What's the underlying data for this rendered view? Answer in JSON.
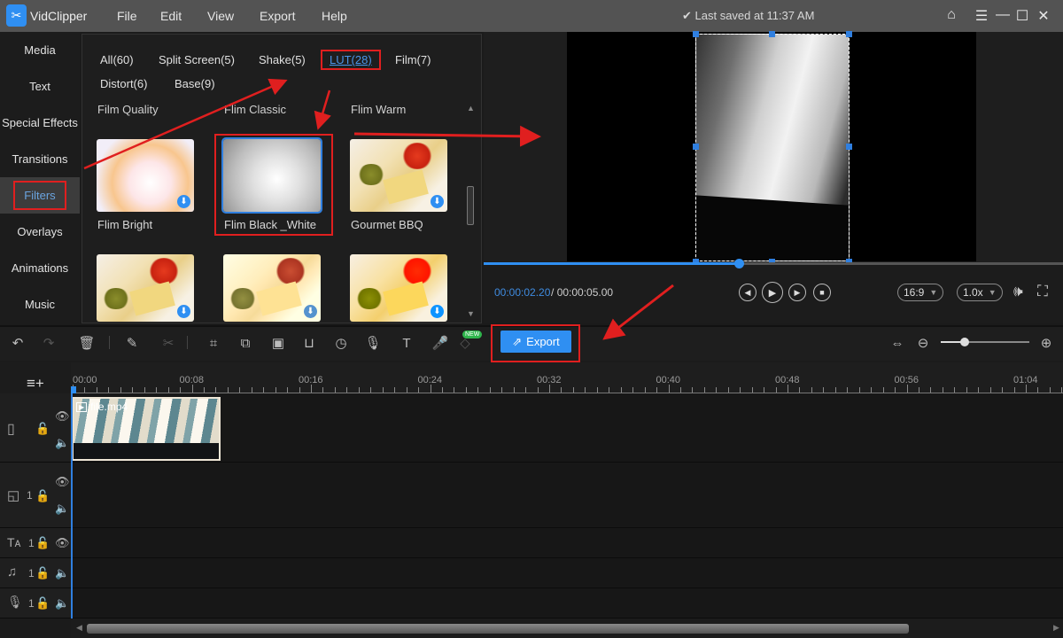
{
  "app": {
    "name": "VidClipper",
    "logo_icon": "scissors-logo-icon"
  },
  "menu": [
    "File",
    "Edit",
    "View",
    "Export",
    "Help"
  ],
  "status": {
    "check_icon": "checkmark-icon",
    "saved_text": "Last saved at 11:37 AM"
  },
  "window_controls": [
    "home-icon",
    "hamburger-menu-icon",
    "minimize-icon",
    "maximize-icon",
    "close-icon"
  ],
  "sidebar": {
    "items": [
      {
        "label": "Media"
      },
      {
        "label": "Text"
      },
      {
        "label": "Special Effects"
      },
      {
        "label": "Transitions"
      },
      {
        "label": "Filters",
        "active": true
      },
      {
        "label": "Overlays"
      },
      {
        "label": "Animations"
      },
      {
        "label": "Music"
      }
    ]
  },
  "library": {
    "categories": [
      {
        "label": "All(60)"
      },
      {
        "label": "Split Screen(5)"
      },
      {
        "label": "Shake(5)"
      },
      {
        "label": "LUT(28)",
        "active": true
      },
      {
        "label": "Film(7)"
      },
      {
        "label": "Distort(6)"
      },
      {
        "label": "Base(9)"
      }
    ],
    "groups": [
      "Film Quality",
      "Flim Classic",
      "Flim Warm"
    ],
    "filters": [
      {
        "label": "Flim Bright"
      },
      {
        "label": "Flim Black _White",
        "selected": true
      },
      {
        "label": "Gourmet BBQ"
      },
      {
        "label": ""
      },
      {
        "label": ""
      },
      {
        "label": ""
      }
    ],
    "download_icon": "download-icon"
  },
  "player": {
    "current_time": "00:00:02.20",
    "separator": "/",
    "total_time": "00:00:05.00",
    "progress": 0.44,
    "aspect_ratio": "16:9",
    "speed": "1.0x",
    "controls": [
      "prev-frame-icon",
      "play-icon",
      "next-frame-icon",
      "stop-icon"
    ]
  },
  "toolbar": {
    "export_label": "Export",
    "new_badge": "NEW",
    "zoom_level": 0.27
  },
  "timeline": {
    "ticks": [
      "00:00",
      "00:08",
      "00:16",
      "00:24",
      "00:32",
      "00:40",
      "00:48",
      "00:56",
      "01:04"
    ],
    "clip": {
      "name": "file.mp4"
    },
    "track_counts": {
      "overlay": "1",
      "text": "1",
      "music": "1",
      "voice": "1"
    }
  },
  "colors": {
    "accent": "#2f8ff2",
    "annotation": "#e01f1f",
    "titlebar": "#535353"
  }
}
